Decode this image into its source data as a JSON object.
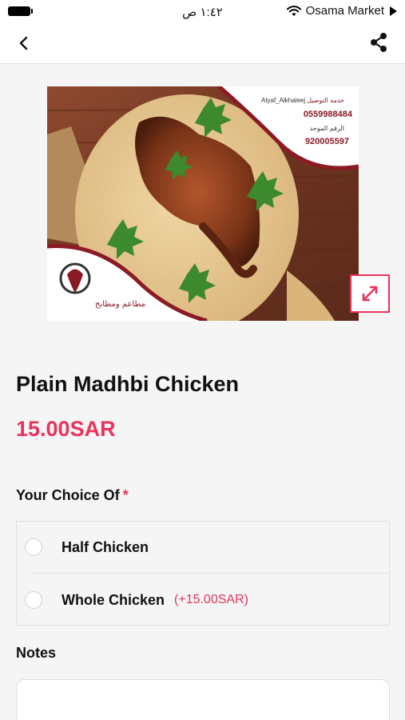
{
  "status_bar": {
    "time": "١:٤٢ ص",
    "carrier": "Osama Market"
  },
  "header": {
    "back_icon": "chevron-left-icon",
    "share_icon": "share-icon"
  },
  "product": {
    "image_alt": "Plain Madhbi Chicken image",
    "image_text": {
      "instagram": "Atyaf_Alkhaleej",
      "delivery_label": "خدمة التوصيل",
      "delivery_phone": "0559988484",
      "unified_label": "الرقم الموحد",
      "unified_phone": "920005597",
      "brand": "مطاعم ومطابخ"
    },
    "title": "Plain Madhbi Chicken",
    "price": "15.00SAR"
  },
  "choice": {
    "label": "Your Choice Of",
    "required_mark": "*",
    "options": [
      {
        "label": "Half Chicken",
        "extra": ""
      },
      {
        "label": "Whole Chicken",
        "extra": "(+15.00SAR)"
      }
    ]
  },
  "notes": {
    "label": "Notes",
    "placeholder": ""
  },
  "colors": {
    "accent": "#e8335c",
    "background": "#f5f5f5"
  }
}
